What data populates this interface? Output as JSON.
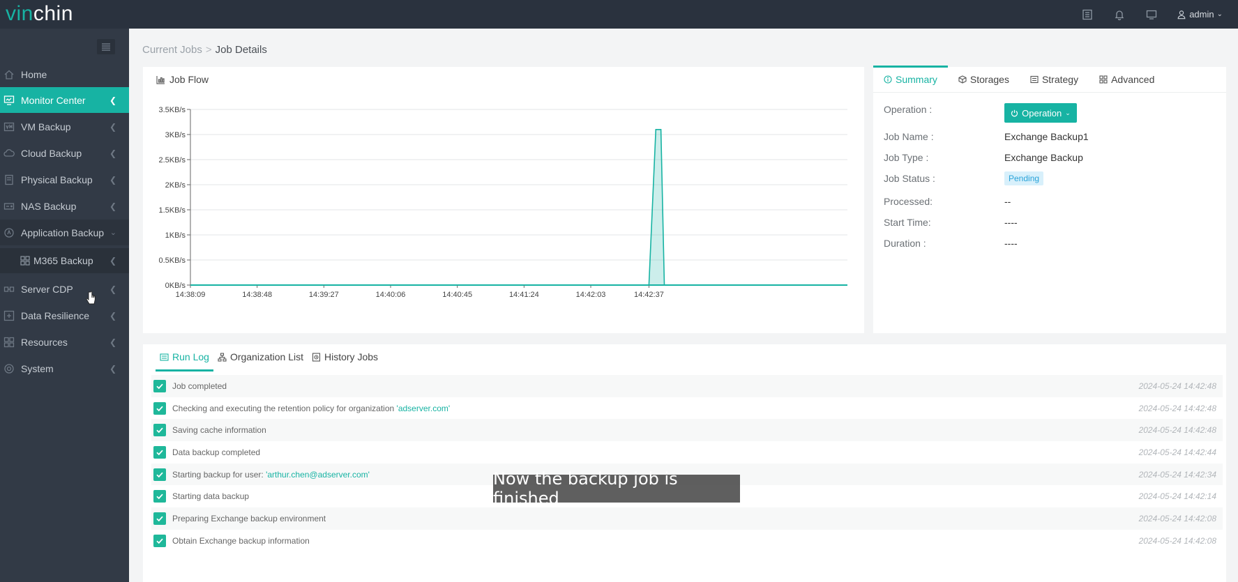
{
  "logo": {
    "part1": "vin",
    "part2": "chin"
  },
  "topbar": {
    "user": "admin",
    "icons": [
      "list-icon",
      "bell-icon",
      "monitor-icon",
      "user-icon"
    ]
  },
  "sidebar": {
    "items": [
      {
        "label": "Home",
        "icon": "home-icon"
      },
      {
        "label": "Monitor Center",
        "icon": "monitor-icon",
        "active": true
      },
      {
        "label": "VM Backup",
        "icon": "vm-icon"
      },
      {
        "label": "Cloud Backup",
        "icon": "cloud-icon"
      },
      {
        "label": "Physical Backup",
        "icon": "server-icon"
      },
      {
        "label": "NAS Backup",
        "icon": "nas-icon"
      },
      {
        "label": "Application Backup",
        "icon": "app-icon",
        "expanded": true
      },
      {
        "label": "M365 Backup",
        "icon": "grid-icon",
        "sub": true
      },
      {
        "label": "Server CDP",
        "icon": "cdp-icon"
      },
      {
        "label": "Data Resilience",
        "icon": "resilience-icon"
      },
      {
        "label": "Resources",
        "icon": "resources-icon"
      },
      {
        "label": "System",
        "icon": "settings-icon"
      }
    ]
  },
  "breadcrumb": {
    "parent": "Current Jobs",
    "separator": ">",
    "current": "Job Details"
  },
  "job_flow": {
    "title": "Job Flow"
  },
  "chart_data": {
    "type": "area",
    "title": "Job Flow",
    "y_ticks": [
      "3.5KB/s",
      "3KB/s",
      "2.5KB/s",
      "2KB/s",
      "1.5KB/s",
      "1KB/s",
      "0.5KB/s",
      "0KB/s"
    ],
    "ylim": [
      0,
      3.5
    ],
    "y_unit": "KB/s",
    "x_ticks": [
      "14:38:09",
      "14:38:48",
      "14:39:27",
      "14:40:06",
      "14:40:45",
      "14:41:24",
      "14:42:03",
      "14:42:37"
    ],
    "grid": true,
    "series": [
      {
        "color": "#17b3a3",
        "points": [
          {
            "t": "14:38:09",
            "v": 0
          },
          {
            "t": "14:42:37",
            "v": 0
          },
          {
            "t": "14:42:41",
            "v": 3.1
          },
          {
            "t": "14:42:44",
            "v": 3.1
          },
          {
            "t": "14:42:46",
            "v": 0
          },
          {
            "t": "14:44:33",
            "v": 0
          }
        ]
      }
    ]
  },
  "summary": {
    "tabs": [
      {
        "label": "Summary",
        "icon": "info-icon",
        "active": true
      },
      {
        "label": "Storages",
        "icon": "box-icon"
      },
      {
        "label": "Strategy",
        "icon": "doc-icon"
      },
      {
        "label": "Advanced",
        "icon": "grid-icon"
      }
    ],
    "operation_label": "Operation :",
    "operation_button": "Operation",
    "fields": [
      {
        "label": "Job Name :",
        "value": "Exchange Backup1"
      },
      {
        "label": "Job Type :",
        "value": "Exchange Backup"
      },
      {
        "label": "Job Status :",
        "value": "Pending"
      },
      {
        "label": "Processed:",
        "value": "--"
      },
      {
        "label": "Start Time:",
        "value": "----"
      },
      {
        "label": "Duration :",
        "value": "----"
      }
    ]
  },
  "runlog": {
    "tabs": [
      {
        "label": "Run Log",
        "icon": "log-icon",
        "active": true
      },
      {
        "label": "Organization List",
        "icon": "org-icon"
      },
      {
        "label": "History Jobs",
        "icon": "history-icon"
      }
    ],
    "entries": [
      {
        "text": "Job completed",
        "highlight": "",
        "time": "2024-05-24 14:42:48"
      },
      {
        "text": "Checking and executing the retention policy for organization ",
        "highlight": "'adserver.com'",
        "time": "2024-05-24 14:42:48"
      },
      {
        "text": "Saving cache information",
        "highlight": "",
        "time": "2024-05-24 14:42:48"
      },
      {
        "text": "Data backup completed",
        "highlight": "",
        "time": "2024-05-24 14:42:44"
      },
      {
        "text": "Starting backup for user: ",
        "highlight": "'arthur.chen@adserver.com'",
        "time": "2024-05-24 14:42:34"
      },
      {
        "text": "Starting data backup",
        "highlight": "",
        "time": "2024-05-24 14:42:14"
      },
      {
        "text": "Preparing Exchange backup environment",
        "highlight": "",
        "time": "2024-05-24 14:42:08"
      },
      {
        "text": "Obtain Exchange backup information",
        "highlight": "",
        "time": "2024-05-24 14:42:08"
      }
    ]
  },
  "caption": "Now the backup job is finished"
}
